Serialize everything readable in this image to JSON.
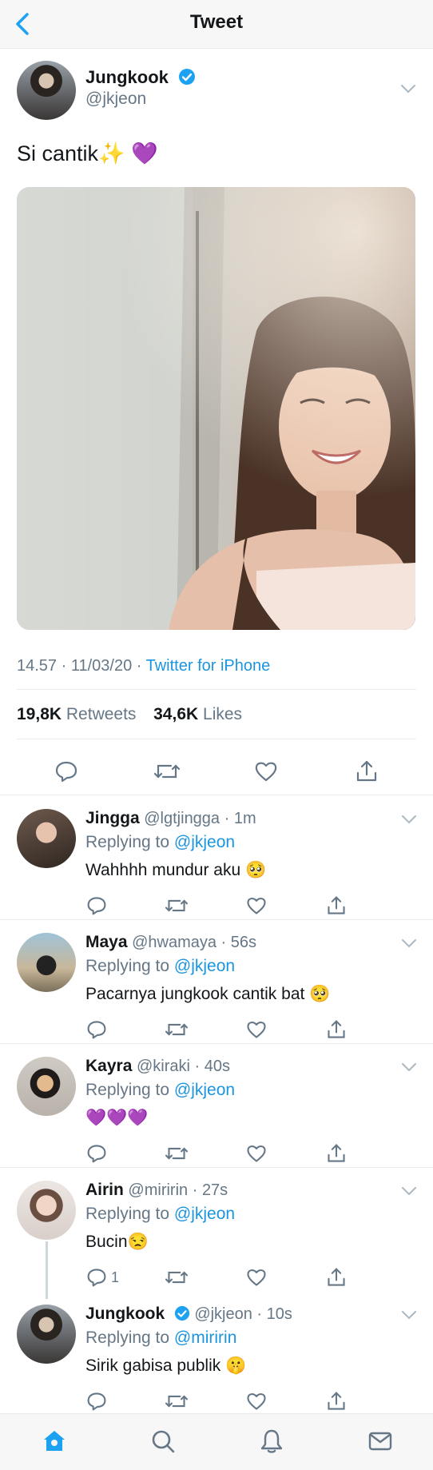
{
  "nav": {
    "title": "Tweet",
    "back_icon": "chevron-left-icon"
  },
  "tweet": {
    "author_name": "Jungkook",
    "author_handle": "@jkjeon",
    "verified": true,
    "text": "Si cantik✨ 💜",
    "timestamp": "14.57 · 11/03/20 · ",
    "source": "Twitter for iPhone",
    "retweets_count": "19,8K",
    "retweets_label": "Retweets",
    "likes_count": "34,6K",
    "likes_label": "Likes"
  },
  "replies": [
    {
      "name": "Jingga",
      "handle": "@lgtjingga",
      "time": "1m",
      "replying_prefix": "Replying to ",
      "replying_to": "@jkjeon",
      "text": "Wahhhh mundur aku 🥺",
      "reply_count": ""
    },
    {
      "name": "Maya",
      "handle": "@hwamaya",
      "time": "56s",
      "replying_prefix": "Replying to ",
      "replying_to": "@jkjeon",
      "text": "Pacarnya jungkook cantik bat 🥺",
      "reply_count": ""
    },
    {
      "name": "Kayra",
      "handle": "@kiraki",
      "time": "40s",
      "replying_prefix": "Replying to ",
      "replying_to": "@jkjeon",
      "text": "💜💜💜",
      "reply_count": ""
    },
    {
      "name": "Airin",
      "handle": "@miririn",
      "time": "27s",
      "replying_prefix": "Replying to ",
      "replying_to": "@jkjeon",
      "text": "Bucin😒",
      "reply_count": "1"
    },
    {
      "name": "Jungkook",
      "handle": "@jkjeon",
      "time": "10s",
      "replying_prefix": "Replying to ",
      "replying_to": "@miririn",
      "text": "Sirik gabisa publik 🤫",
      "reply_count": "",
      "verified": true
    }
  ],
  "tabbar": {
    "items": [
      "home-icon",
      "search-icon",
      "notifications-icon",
      "messages-icon"
    ]
  },
  "colors": {
    "accent": "#1da1f2",
    "link": "#1b95e0",
    "secondary_text": "#657786",
    "border": "#e6ecf0"
  }
}
